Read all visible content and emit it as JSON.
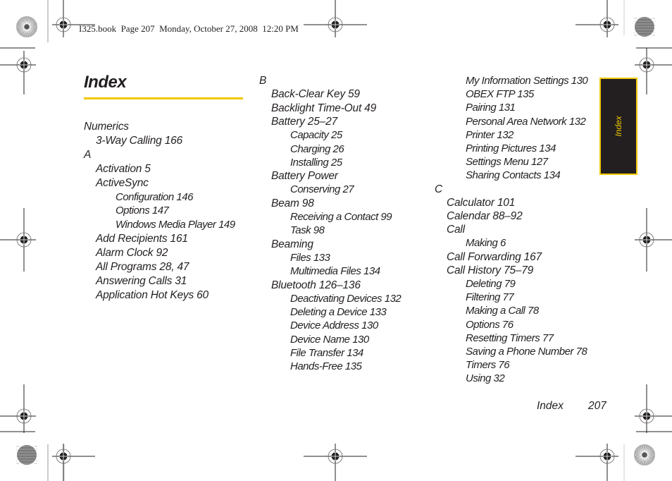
{
  "header": {
    "stamp": "I325.book  Page 207  Monday, October 27, 2008  12:20 PM"
  },
  "page": {
    "title": "Index",
    "side_tab_label": "Index",
    "footer_section": "Index",
    "footer_page_number": "207",
    "accent_color": "#f0c800",
    "tab_background": "#231f20"
  },
  "columns": [
    {
      "entries": [
        {
          "text": "Numerics",
          "level": 0
        },
        {
          "text": "3-Way Calling 166",
          "level": 1
        },
        {
          "text": "A",
          "level": 0
        },
        {
          "text": "Activation 5",
          "level": 1
        },
        {
          "text": "ActiveSync",
          "level": 1
        },
        {
          "text": "Configuration 146",
          "level": 2
        },
        {
          "text": "Options 147",
          "level": 2
        },
        {
          "text": "Windows Media Player 149",
          "level": 2
        },
        {
          "text": "Add Recipients 161",
          "level": 1
        },
        {
          "text": "Alarm Clock 92",
          "level": 1
        },
        {
          "text": "All Programs 28, 47",
          "level": 1
        },
        {
          "text": "Answering Calls 31",
          "level": 1
        },
        {
          "text": "Application Hot Keys 60",
          "level": 1
        }
      ]
    },
    {
      "entries": [
        {
          "text": "B",
          "level": 0
        },
        {
          "text": "Back-Clear Key 59",
          "level": 1
        },
        {
          "text": "Backlight Time-Out 49",
          "level": 1
        },
        {
          "text": "Battery 25–27",
          "level": 1
        },
        {
          "text": "Capacity 25",
          "level": 2
        },
        {
          "text": "Charging 26",
          "level": 2
        },
        {
          "text": "Installing 25",
          "level": 2
        },
        {
          "text": "Battery Power",
          "level": 1
        },
        {
          "text": "Conserving 27",
          "level": 2
        },
        {
          "text": "Beam 98",
          "level": 1
        },
        {
          "text": "Receiving a Contact 99",
          "level": 2
        },
        {
          "text": "Task 98",
          "level": 2
        },
        {
          "text": "Beaming",
          "level": 1
        },
        {
          "text": "Files 133",
          "level": 2
        },
        {
          "text": "Multimedia Files 134",
          "level": 2
        },
        {
          "text": "Bluetooth 126–136",
          "level": 1
        },
        {
          "text": "Deactivating Devices 132",
          "level": 2
        },
        {
          "text": "Deleting a Device 133",
          "level": 2
        },
        {
          "text": "Device Address 130",
          "level": 2
        },
        {
          "text": "Device Name 130",
          "level": 2
        },
        {
          "text": "File Transfer 134",
          "level": 2
        },
        {
          "text": "Hands-Free 135",
          "level": 2
        }
      ]
    },
    {
      "entries": [
        {
          "text": "My Information Settings 130",
          "level": 2
        },
        {
          "text": "OBEX FTP 135",
          "level": 2
        },
        {
          "text": "Pairing 131",
          "level": 2
        },
        {
          "text": "Personal Area Network 132",
          "level": 2
        },
        {
          "text": "Printer 132",
          "level": 2
        },
        {
          "text": "Printing Pictures 134",
          "level": 2
        },
        {
          "text": "Settings Menu 127",
          "level": 2
        },
        {
          "text": "Sharing Contacts 134",
          "level": 2
        },
        {
          "text": "C",
          "level": 0
        },
        {
          "text": "Calculator 101",
          "level": 1
        },
        {
          "text": "Calendar 88–92",
          "level": 1
        },
        {
          "text": "Call",
          "level": 1
        },
        {
          "text": "Making 6",
          "level": 2
        },
        {
          "text": "Call Forwarding 167",
          "level": 1
        },
        {
          "text": "Call History 75–79",
          "level": 1
        },
        {
          "text": "Deleting 79",
          "level": 2
        },
        {
          "text": "Filtering 77",
          "level": 2
        },
        {
          "text": "Making a Call 78",
          "level": 2
        },
        {
          "text": "Options 76",
          "level": 2
        },
        {
          "text": "Resetting Timers 77",
          "level": 2
        },
        {
          "text": "Saving a Phone Number 78",
          "level": 2
        },
        {
          "text": "Timers 76",
          "level": 2
        },
        {
          "text": "Using 32",
          "level": 2
        }
      ]
    }
  ]
}
